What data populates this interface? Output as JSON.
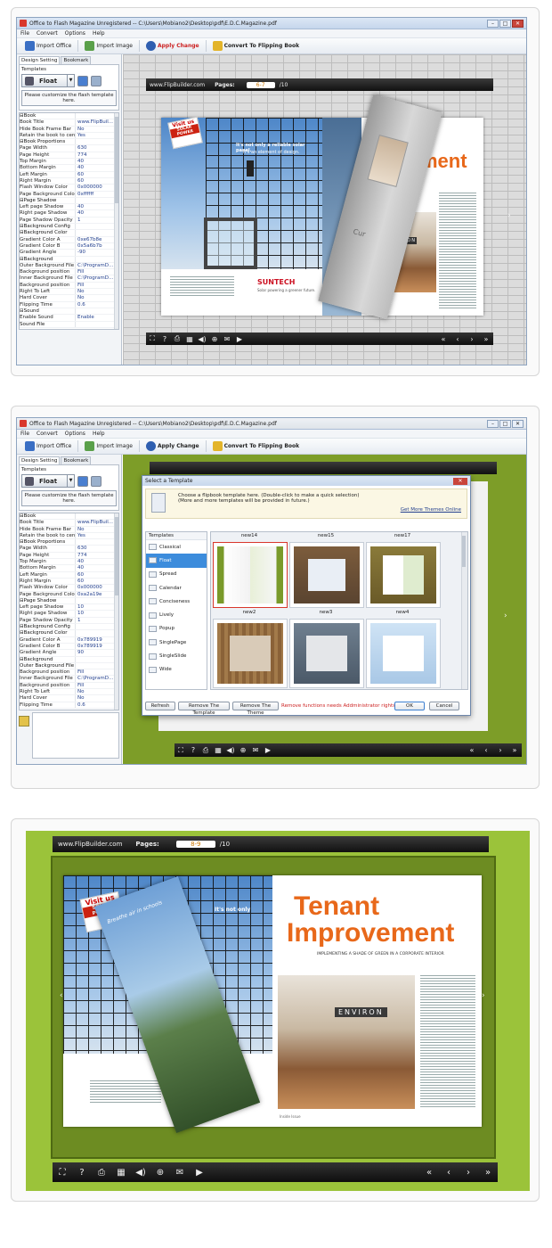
{
  "screen1": {
    "title": "Office to Flash Magazine Unregistered -- C:\\Users\\Mobiano2\\Desktop\\pdf\\E.D.C.Magazine.pdf",
    "menu": [
      "File",
      "Convert",
      "Options",
      "Help"
    ],
    "toolbar": {
      "import_office": "Import Office",
      "import_image": "Import Image",
      "apply_change": "Apply Change",
      "convert": "Convert To Flipping Book"
    },
    "tabs": [
      "Design Setting",
      "Bookmark"
    ],
    "templates_label": "Templates",
    "template_name": "Float",
    "customize": "Please customize the flash template here.",
    "props": [
      [
        "⊟Book",
        ""
      ],
      [
        "   Book Title",
        "www.FlipBuil..."
      ],
      [
        "   Hide Book Frame Bar",
        "No"
      ],
      [
        "   Retain the book to center",
        "Yes"
      ],
      [
        "  ⊟Book Proportions",
        ""
      ],
      [
        "     Page Width",
        "630"
      ],
      [
        "     Page Height",
        "774"
      ],
      [
        "     Top Margin",
        "40"
      ],
      [
        "     Bottom Margin",
        "40"
      ],
      [
        "     Left Margin",
        "60"
      ],
      [
        "     Right Margin",
        "60"
      ],
      [
        "   Flash Window Color",
        "0x000000"
      ],
      [
        "   Page Background Color",
        "0xffffff"
      ],
      [
        "  ⊟Page Shadow",
        ""
      ],
      [
        "     Left page Shadow",
        "40"
      ],
      [
        "     Right page Shadow",
        "40"
      ],
      [
        "     Page Shadow Opacity",
        "1"
      ],
      [
        "  ⊟Background Config",
        ""
      ],
      [
        "    ⊟Background Color",
        ""
      ],
      [
        "       Gradient Color A",
        "0xe67b8e"
      ],
      [
        "       Gradient Color B",
        "0x5a6b7b"
      ],
      [
        "       Gradient Angle",
        "-90"
      ],
      [
        "    ⊟Background",
        ""
      ],
      [
        "       Outer Background File",
        "C:\\ProgramD..."
      ],
      [
        "       Background position",
        "Fill"
      ],
      [
        "       Inner Background File",
        "C:\\ProgramD..."
      ],
      [
        "       Background position",
        "Fill"
      ],
      [
        "   Right To Left",
        "No"
      ],
      [
        "   Hard Cover",
        "No"
      ],
      [
        "   Flipping Time",
        "0.6"
      ],
      [
        "⊟Sound",
        ""
      ],
      [
        "   Enable Sound",
        "Enable"
      ],
      [
        "   Sound File",
        ""
      ]
    ],
    "viewer": {
      "site": "www.FlipBuilder.com",
      "pages_label": "Pages:",
      "page_value": "6-7",
      "total": "/10"
    },
    "book": {
      "tag_visit": "Visit us",
      "tag_brand": "SOLAR POWER",
      "slogan1": "It's not only a reliable solar panel.",
      "slogan2": "It's an element of design.",
      "suntech": "SUNTECH",
      "suntech_sub": "Solar powering a greener future.",
      "headline": "ment",
      "environ": "ENVIRON",
      "cur": "Cur"
    }
  },
  "screen2": {
    "title": "Office to Flash Magazine Unregistered -- C:\\Users\\Mobiano2\\Desktop\\pdf\\E.D.C.Magazine.pdf",
    "menu": [
      "File",
      "Convert",
      "Options",
      "Help"
    ],
    "props": [
      [
        "⊟Book",
        ""
      ],
      [
        "   Book Title",
        "www.FlipBuil..."
      ],
      [
        "   Hide Book Frame Bar",
        "No"
      ],
      [
        "   Retain the book to center",
        "Yes"
      ],
      [
        "  ⊟Book Proportions",
        ""
      ],
      [
        "     Page Width",
        "630"
      ],
      [
        "     Page Height",
        "774"
      ],
      [
        "     Top Margin",
        "40"
      ],
      [
        "     Bottom Margin",
        "40"
      ],
      [
        "     Left Margin",
        "60"
      ],
      [
        "     Right Margin",
        "60"
      ],
      [
        "   Flash Window Color",
        "0x000000"
      ],
      [
        "   Page Background Color",
        "0xa2a19e"
      ],
      [
        "  ⊟Page Shadow",
        ""
      ],
      [
        "     Left page Shadow",
        "10"
      ],
      [
        "     Right page Shadow",
        "10"
      ],
      [
        "     Page Shadow Opacity",
        "1"
      ],
      [
        "  ⊟Background Config",
        ""
      ],
      [
        "    ⊟Background Color",
        ""
      ],
      [
        "       Gradient Color A",
        "0x789919"
      ],
      [
        "       Gradient Color B",
        "0x789919"
      ],
      [
        "       Gradient Angle",
        "90"
      ],
      [
        "    ⊟Background",
        ""
      ],
      [
        "       Outer Background File",
        ""
      ],
      [
        "       Background position",
        "Fill"
      ],
      [
        "       Inner Background File",
        "C:\\ProgramD..."
      ],
      [
        "       Background position",
        "Fill"
      ],
      [
        "   Right To Left",
        "No"
      ],
      [
        "   Hard Cover",
        "No"
      ],
      [
        "   Flipping Time",
        "0.6"
      ]
    ],
    "dialog": {
      "title": "Select a Template",
      "info1": "Choose a flipbook template here. (Double-click to make a quick selection)",
      "info2": "(More and more templates will be provided in future.)",
      "more": "Get More Themes Online",
      "list_header": "Templates",
      "list": [
        "Classical",
        "Float",
        "Spread",
        "Calendar",
        "Conciseness",
        "Lively",
        "Popup",
        "SinglePage",
        "SingleSlide",
        "Wide"
      ],
      "col_heads": [
        "new14",
        "new15",
        "new17"
      ],
      "row2_heads": [
        "new2",
        "new3",
        "new4"
      ],
      "refresh": "Refresh",
      "remove_template": "Remove The Template",
      "remove_theme": "Remove The Theme",
      "warning": "Remove functions needs Addministrator rights!",
      "ok": "OK",
      "cancel": "Cancel"
    }
  },
  "screen3": {
    "viewer": {
      "site": "www.FlipBuilder.com",
      "pages_label": "Pages:",
      "page_value": "8-9",
      "total": "/10"
    },
    "book": {
      "tag_visit": "Visit us",
      "tag_brand": "SOLAR POWER",
      "slogan": "It's not only",
      "headline1": "Tenant",
      "headline2": "Improvement",
      "subhead": "IMPLEMENTING A SHADE OF GREEN IN A CORPORATE INTERIOR",
      "environ": "ENVIRON",
      "brochure": "Breathe air in schools",
      "footer": "Inside Issue"
    }
  },
  "colors": {
    "green": "#7d9d28",
    "brick": "#dcdcdc",
    "orange": "#e8681a",
    "red": "#c22222"
  }
}
